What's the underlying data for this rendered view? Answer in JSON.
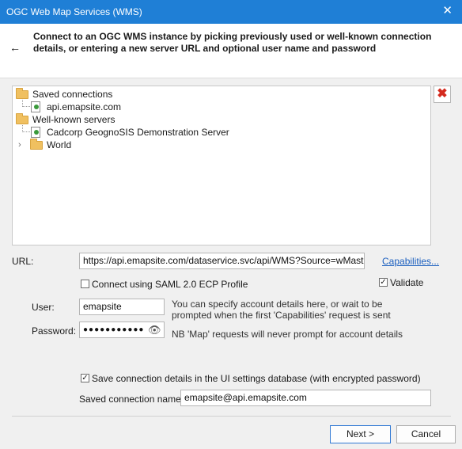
{
  "window": {
    "title": "OGC Web Map Services (WMS)",
    "close_glyph": "✕"
  },
  "header": {
    "back_glyph": "←",
    "instruction": "Connect to an OGC WMS instance by picking previously used or well-known connection details, or entering a new server URL and optional user name and password"
  },
  "tree": {
    "saved_connections": {
      "label": "Saved connections",
      "icon": "folder-icon",
      "children": [
        {
          "label": "api.emapsite.com",
          "icon": "server-icon"
        }
      ]
    },
    "well_known_servers": {
      "label": "Well-known servers",
      "icon": "folder-icon",
      "children": [
        {
          "label": "Cadcorp GeognoSIS Demonstration Server",
          "icon": "server-icon"
        },
        {
          "label": "World",
          "icon": "folder-icon",
          "expand_glyph": "›"
        }
      ]
    }
  },
  "delete_glyph": "✖",
  "form": {
    "url_label": "URL:",
    "url_value": "https://api.emapsite.com/dataservice.svc/api/WMS?Source=wMasterMap",
    "capabilities_link": "Capabilities...",
    "saml_label": "Connect using SAML 2.0 ECP Profile",
    "saml_checked": false,
    "validate_label": "Validate",
    "validate_checked": true,
    "user_label": "User:",
    "user_value": "emapsite",
    "user_hint": "You can specify account details here, or wait to be prompted when the first 'Capabilities' request is sent",
    "password_label": "Password:",
    "password_value": "●●●●●●●●●●●",
    "eye_glyph": "👁",
    "password_hint": "NB 'Map' requests will never prompt for account details",
    "save_label": "Save connection details in the UI settings database (with encrypted password)",
    "save_checked": true,
    "saved_name_label": "Saved connection name:",
    "saved_name_value": "emapsite@api.emapsite.com",
    "check_glyph": "✓"
  },
  "buttons": {
    "next": "Next >",
    "cancel": "Cancel"
  },
  "colors": {
    "titlebar": "#1f7fd6",
    "link": "#1b5fbf",
    "delete": "#d42a1e",
    "folder": "#f0c060"
  }
}
